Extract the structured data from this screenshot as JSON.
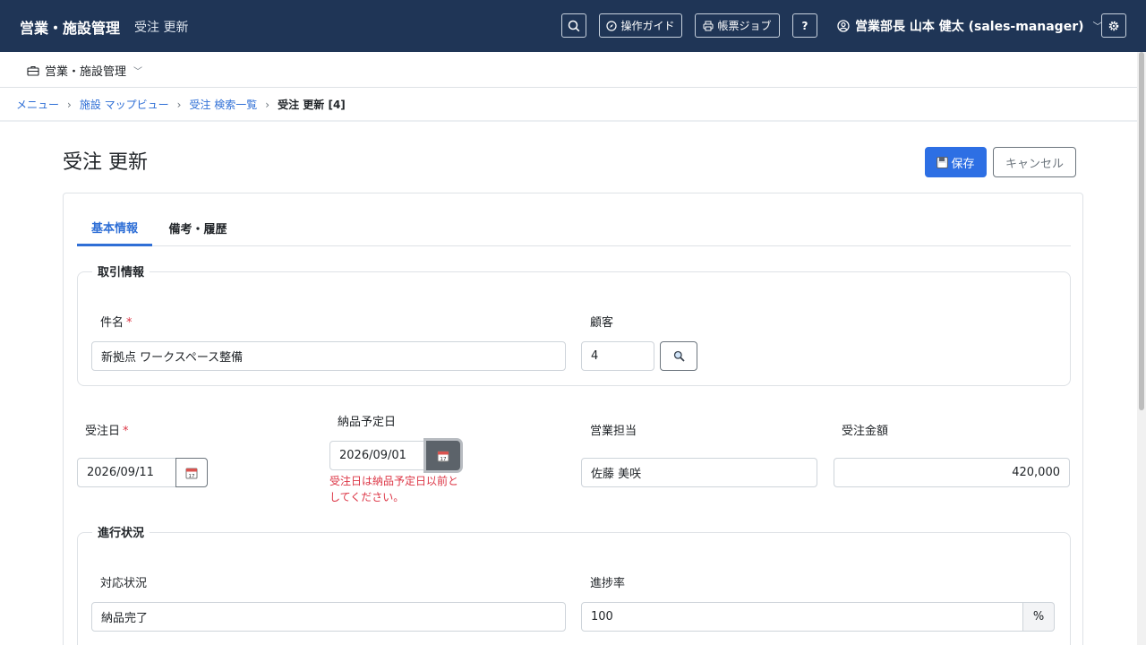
{
  "header": {
    "app_name": "営業・施設管理",
    "page_subtitle": "受注 更新",
    "guide_label": "操作ガイド",
    "report_jobs_label": "帳票ジョブ",
    "help_label": "?",
    "user_label": "営業部長 山本 健太 (sales-manager)"
  },
  "module_menu": {
    "label": "営業・施設管理"
  },
  "breadcrumb": {
    "items": [
      "メニュー",
      "施設 マップビュー",
      "受注 検索一覧"
    ],
    "current": "受注 更新 [4]"
  },
  "page": {
    "title": "受注 更新",
    "save_label": "保存",
    "cancel_label": "キャンセル"
  },
  "tabs": [
    {
      "label": "基本情報",
      "active": true
    },
    {
      "label": "備考・履歴",
      "active": false
    }
  ],
  "section_transaction": {
    "legend": "取引情報",
    "subject_label": "件名",
    "subject_value": "新拠点 ワークスペース整備",
    "customer_label": "顧客",
    "customer_value": "4"
  },
  "fields": {
    "order_date_label": "受注日",
    "order_date_value": "2026/09/11",
    "delivery_date_label": "納品予定日",
    "delivery_date_value": "2026/09/01",
    "delivery_date_error": "受注日は納品予定日以前としてください。",
    "sales_rep_label": "営業担当",
    "sales_rep_value": "佐藤 美咲",
    "amount_label": "受注金額",
    "amount_value": "420,000"
  },
  "section_progress": {
    "legend": "進行状況",
    "status_label": "対応状況",
    "status_value": "納品完了",
    "progress_label": "進捗率",
    "progress_value": "100",
    "progress_unit": "%"
  },
  "colors": {
    "header_bg": "#1f3556",
    "primary": "#2d6fe4",
    "link": "#2f6fd6",
    "danger": "#dc3545"
  }
}
